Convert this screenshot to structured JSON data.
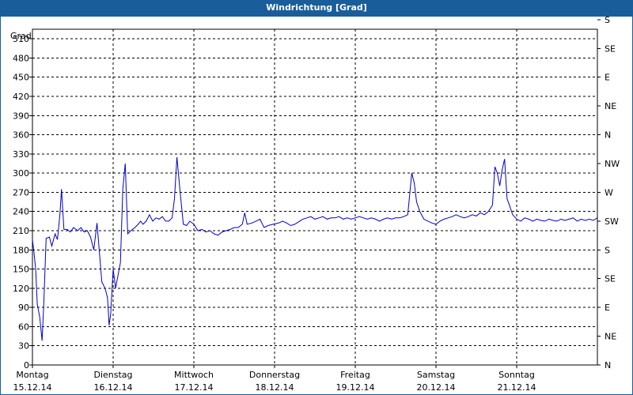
{
  "window": {
    "title": "Windrichtung [Grad]"
  },
  "chart_data": {
    "type": "line",
    "title": "Windrichtung [Grad]",
    "ylabel": "Grad",
    "ylim": [
      0,
      525
    ],
    "left_ticks": [
      "0",
      "30",
      "60",
      "90",
      "120",
      "150",
      "180",
      "210",
      "240",
      "270",
      "300",
      "330",
      "360",
      "390",
      "420",
      "450",
      "480",
      "510"
    ],
    "right_ticks": [
      "N",
      "NE",
      "E",
      "SE",
      "S",
      "SW",
      "W",
      "NW",
      "N",
      "NE",
      "E",
      "SE",
      "S"
    ],
    "day_labels": [
      {
        "day": "Montag",
        "date": "15.12.14"
      },
      {
        "day": "Dienstag",
        "date": "16.12.14"
      },
      {
        "day": "Mittwoch",
        "date": "17.12.14"
      },
      {
        "day": "Donnerstag",
        "date": "18.12.14"
      },
      {
        "day": "Freitag",
        "date": "19.12.14"
      },
      {
        "day": "Samstag",
        "date": "20.12.14"
      },
      {
        "day": "Sonntag",
        "date": "21.12.14"
      }
    ],
    "grid": true,
    "series": [
      {
        "color": "#0000cc",
        "points": [
          [
            0.0,
            196
          ],
          [
            0.02,
            175
          ],
          [
            0.04,
            150
          ],
          [
            0.06,
            95
          ],
          [
            0.09,
            75
          ],
          [
            0.12,
            38
          ],
          [
            0.14,
            95
          ],
          [
            0.17,
            198
          ],
          [
            0.21,
            200
          ],
          [
            0.24,
            186
          ],
          [
            0.28,
            205
          ],
          [
            0.31,
            196
          ],
          [
            0.34,
            235
          ],
          [
            0.36,
            275
          ],
          [
            0.39,
            212
          ],
          [
            0.43,
            212
          ],
          [
            0.47,
            208
          ],
          [
            0.51,
            215
          ],
          [
            0.56,
            210
          ],
          [
            0.6,
            215
          ],
          [
            0.64,
            208
          ],
          [
            0.68,
            210
          ],
          [
            0.72,
            200
          ],
          [
            0.76,
            180
          ],
          [
            0.8,
            222
          ],
          [
            0.83,
            175
          ],
          [
            0.86,
            130
          ],
          [
            0.9,
            120
          ],
          [
            0.93,
            105
          ],
          [
            0.95,
            62
          ],
          [
            0.97,
            80
          ],
          [
            1.0,
            150
          ],
          [
            1.03,
            120
          ],
          [
            1.06,
            140
          ],
          [
            1.09,
            160
          ],
          [
            1.12,
            275
          ],
          [
            1.15,
            315
          ],
          [
            1.18,
            205
          ],
          [
            1.22,
            210
          ],
          [
            1.27,
            215
          ],
          [
            1.31,
            220
          ],
          [
            1.34,
            225
          ],
          [
            1.37,
            220
          ],
          [
            1.41,
            225
          ],
          [
            1.45,
            235
          ],
          [
            1.49,
            225
          ],
          [
            1.53,
            230
          ],
          [
            1.57,
            228
          ],
          [
            1.61,
            232
          ],
          [
            1.65,
            225
          ],
          [
            1.69,
            225
          ],
          [
            1.73,
            230
          ],
          [
            1.76,
            260
          ],
          [
            1.79,
            325
          ],
          [
            1.83,
            270
          ],
          [
            1.87,
            220
          ],
          [
            1.91,
            218
          ],
          [
            1.95,
            225
          ],
          [
            2.0,
            220
          ],
          [
            2.05,
            210
          ],
          [
            2.1,
            212
          ],
          [
            2.15,
            208
          ],
          [
            2.2,
            210
          ],
          [
            2.25,
            205
          ],
          [
            2.3,
            203
          ],
          [
            2.35,
            208
          ],
          [
            2.4,
            210
          ],
          [
            2.45,
            212
          ],
          [
            2.5,
            215
          ],
          [
            2.55,
            215
          ],
          [
            2.6,
            220
          ],
          [
            2.63,
            238
          ],
          [
            2.66,
            220
          ],
          [
            2.72,
            222
          ],
          [
            2.77,
            225
          ],
          [
            2.82,
            228
          ],
          [
            2.87,
            215
          ],
          [
            2.92,
            218
          ],
          [
            2.98,
            220
          ],
          [
            3.05,
            222
          ],
          [
            3.1,
            225
          ],
          [
            3.15,
            222
          ],
          [
            3.2,
            218
          ],
          [
            3.25,
            220
          ],
          [
            3.3,
            224
          ],
          [
            3.35,
            228
          ],
          [
            3.4,
            230
          ],
          [
            3.45,
            232
          ],
          [
            3.5,
            228
          ],
          [
            3.55,
            230
          ],
          [
            3.6,
            232
          ],
          [
            3.65,
            228
          ],
          [
            3.7,
            230
          ],
          [
            3.75,
            230
          ],
          [
            3.8,
            232
          ],
          [
            3.85,
            228
          ],
          [
            3.9,
            230
          ],
          [
            3.95,
            228
          ],
          [
            4.0,
            230
          ],
          [
            4.05,
            232
          ],
          [
            4.1,
            230
          ],
          [
            4.15,
            228
          ],
          [
            4.2,
            230
          ],
          [
            4.25,
            228
          ],
          [
            4.3,
            225
          ],
          [
            4.35,
            228
          ],
          [
            4.4,
            230
          ],
          [
            4.45,
            228
          ],
          [
            4.5,
            230
          ],
          [
            4.55,
            230
          ],
          [
            4.6,
            232
          ],
          [
            4.65,
            235
          ],
          [
            4.7,
            300
          ],
          [
            4.73,
            285
          ],
          [
            4.76,
            255
          ],
          [
            4.8,
            240
          ],
          [
            4.85,
            228
          ],
          [
            4.9,
            225
          ],
          [
            4.95,
            222
          ],
          [
            5.0,
            220
          ],
          [
            5.05,
            225
          ],
          [
            5.1,
            228
          ],
          [
            5.15,
            230
          ],
          [
            5.2,
            232
          ],
          [
            5.25,
            235
          ],
          [
            5.3,
            232
          ],
          [
            5.35,
            230
          ],
          [
            5.4,
            232
          ],
          [
            5.45,
            235
          ],
          [
            5.5,
            233
          ],
          [
            5.55,
            238
          ],
          [
            5.6,
            235
          ],
          [
            5.65,
            240
          ],
          [
            5.7,
            250
          ],
          [
            5.73,
            310
          ],
          [
            5.76,
            300
          ],
          [
            5.79,
            280
          ],
          [
            5.82,
            305
          ],
          [
            5.85,
            322
          ],
          [
            5.88,
            260
          ],
          [
            5.91,
            250
          ],
          [
            5.95,
            235
          ],
          [
            6.0,
            228
          ],
          [
            6.05,
            225
          ],
          [
            6.1,
            230
          ],
          [
            6.15,
            228
          ],
          [
            6.2,
            225
          ],
          [
            6.25,
            228
          ],
          [
            6.3,
            226
          ],
          [
            6.35,
            225
          ],
          [
            6.4,
            228
          ],
          [
            6.45,
            226
          ],
          [
            6.5,
            225
          ],
          [
            6.55,
            228
          ],
          [
            6.6,
            226
          ],
          [
            6.65,
            228
          ],
          [
            6.7,
            230
          ],
          [
            6.75,
            225
          ],
          [
            6.8,
            228
          ],
          [
            6.85,
            226
          ],
          [
            6.9,
            228
          ],
          [
            6.95,
            226
          ],
          [
            7.0,
            230
          ]
        ]
      }
    ]
  }
}
